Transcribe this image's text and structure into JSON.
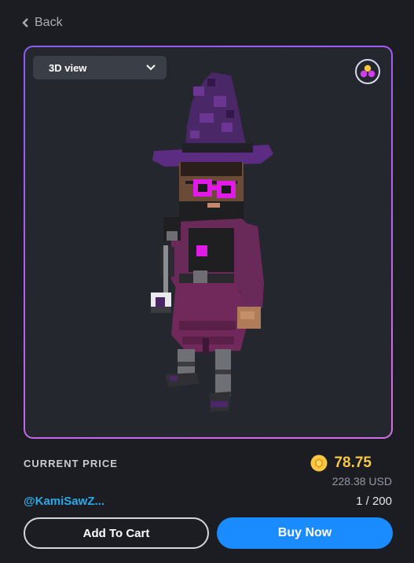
{
  "nav": {
    "back_label": "Back"
  },
  "viewer": {
    "view_mode": "3D view",
    "ar_icon": "ar-rings-icon",
    "border_gradient": [
      "#8a5cf6",
      "#d46ee6"
    ]
  },
  "price": {
    "label": "CURRENT PRICE",
    "coin_icon": "sand-coin-icon",
    "value": "78.75",
    "usd": "228.38 USD",
    "color": "#f7c744"
  },
  "item": {
    "creator": "@KamiSawZ...",
    "edition": "1 / 200"
  },
  "actions": {
    "add_to_cart": "Add To Cart",
    "buy_now": "Buy Now",
    "buy_color": "#1a8cff"
  }
}
